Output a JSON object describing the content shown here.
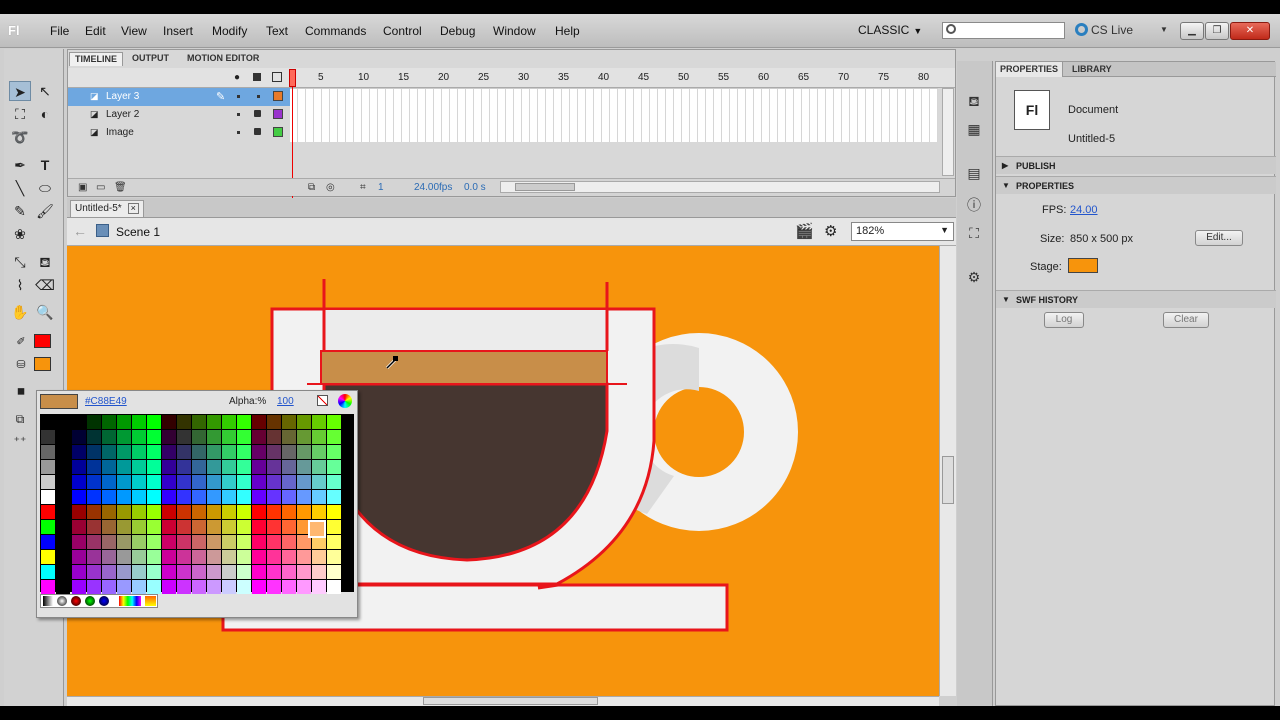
{
  "menubar": {
    "app_logo": "Fl",
    "items": [
      "File",
      "Edit",
      "View",
      "Insert",
      "Modify",
      "Text",
      "Commands",
      "Control",
      "Debug",
      "Window",
      "Help"
    ],
    "workspace": "CLASSIC",
    "cs_live": "CS Live"
  },
  "timeline": {
    "tabs": [
      "TIMELINE",
      "OUTPUT",
      "MOTION EDITOR"
    ],
    "frame_numbers": [
      "5",
      "10",
      "15",
      "20",
      "25",
      "30",
      "35",
      "40",
      "45",
      "50",
      "55",
      "60",
      "65",
      "70",
      "75",
      "80"
    ],
    "layers": [
      {
        "name": "Layer 3",
        "color": "#e87a2a",
        "active": true
      },
      {
        "name": "Layer 2",
        "color": "#9933cc",
        "active": false
      },
      {
        "name": "Image",
        "color": "#44cc44",
        "active": false
      }
    ],
    "current_frame": "1",
    "fps": "24.00fps",
    "time": "0.0 s"
  },
  "document": {
    "tab_title": "Untitled-5*",
    "scene": "Scene 1",
    "zoom": "182%"
  },
  "color_popup": {
    "hex": "#C88E49",
    "current_color": "#C88E49",
    "alpha_label": "Alpha:%",
    "alpha_value": "100"
  },
  "tools": {
    "stroke_color": "#ff0000",
    "fill_color": "#f7940c"
  },
  "properties": {
    "tabs": [
      "PROPERTIES",
      "LIBRARY"
    ],
    "doc_type": "Document",
    "doc_name": "Untitled-5",
    "doc_icon": "Fl",
    "sections": {
      "publish": "PUBLISH",
      "properties": "PROPERTIES",
      "swf_history": "SWF HISTORY"
    },
    "fps_label": "FPS:",
    "fps_value": "24.00",
    "size_label": "Size:",
    "size_value": "850 x 500 px",
    "edit_button": "Edit...",
    "stage_label": "Stage:",
    "stage_color": "#f7940c",
    "log_button": "Log",
    "clear_button": "Clear"
  },
  "colors": {
    "stage_bg": "#f7940c",
    "cup_white": "#f2f2f2",
    "coffee": "#463630",
    "foam": "#c88e49",
    "selection_outline": "#e8151b"
  }
}
